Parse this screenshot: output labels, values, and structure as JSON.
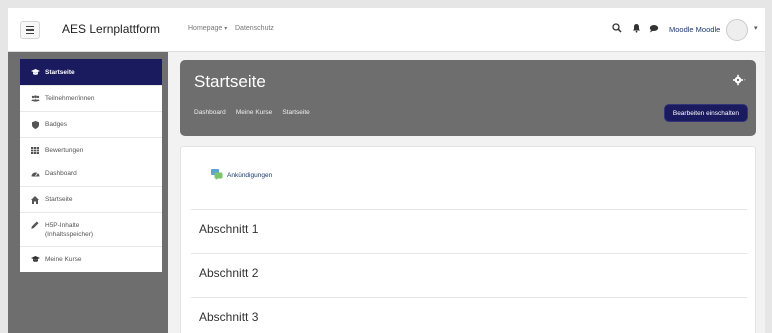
{
  "navbar": {
    "brand": "AES Lernplattform",
    "links": [
      {
        "label": "Homepage",
        "has_dropdown": true
      },
      {
        "label": "Datenschutz",
        "has_dropdown": false
      }
    ],
    "icons": [
      "search-icon",
      "bell-icon",
      "chat-icon"
    ],
    "user_name": "Moodle Moodle"
  },
  "sidebar": {
    "group1": [
      {
        "label": "Startseite",
        "icon": "graduation-cap-icon",
        "active": true
      },
      {
        "label": "Teilnehmer/innen",
        "icon": "users-icon",
        "active": false
      },
      {
        "label": "Badges",
        "icon": "shield-icon",
        "active": false
      },
      {
        "label": "Bewertungen",
        "icon": "table-icon",
        "active": false
      }
    ],
    "group2": [
      {
        "label": "Dashboard",
        "icon": "dashboard-icon"
      },
      {
        "label": "Startseite",
        "icon": "home-icon"
      },
      {
        "label": "H5P-Inhalte\n(Inhaltsspeicher)",
        "icon": "pencil-icon"
      },
      {
        "label": "Meine Kurse",
        "icon": "graduation-cap-icon"
      }
    ]
  },
  "header": {
    "title": "Startseite",
    "breadcrumb": [
      "Dashboard",
      "Meine Kurse",
      "Startseite"
    ],
    "edit_button": "Bearbeiten einschalten"
  },
  "content": {
    "announcement": "Ankündigungen",
    "sections": [
      "Abschnitt 1",
      "Abschnitt 2",
      "Abschnitt 3"
    ]
  },
  "colors": {
    "accent": "#1a1a5e",
    "header_bg": "#6e6e6e",
    "sidebar_bg": "#6e6e6e"
  }
}
